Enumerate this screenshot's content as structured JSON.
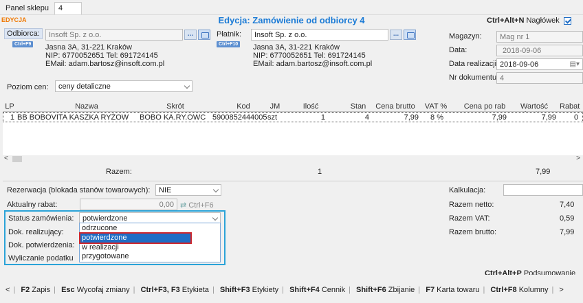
{
  "tabbar": {
    "label": "Panel sklepu",
    "tab_number": "4"
  },
  "mode": "EDYCJA",
  "title": "Edycja: Zamówienie od odbiorcy 4",
  "header_shortcut": {
    "keys": "Ctrl+Alt+N",
    "label": "Nagłówek"
  },
  "customer": {
    "label": "Odbiorca:",
    "shortcut": "Ctrl+F9",
    "value": "Insoft Sp. z o.o.",
    "address": "Jasna 3A, 31-221 Kraków",
    "nip": "NIP: 6770052651 Tel: 691724145",
    "email": "EMail: adam.bartosz@insoft.com.pl"
  },
  "payer": {
    "label": "Płatnik:",
    "shortcut": "Ctrl+F10",
    "value": "Insoft Sp. z o.o.",
    "address": "Jasna 3A, 31-221 Kraków",
    "nip": "NIP: 6770052651 Tel: 691724145",
    "email": "EMail: adam.bartosz@insoft.com.pl"
  },
  "more_button": "...",
  "warehouse": {
    "label": "Magazyn:",
    "value": "Mag nr 1"
  },
  "date": {
    "label": "Data:",
    "value": "2018-09-06"
  },
  "realization_date": {
    "label": "Data realizacji:",
    "value": "2018-09-06"
  },
  "doc_number": {
    "label": "Nr dokumentu:",
    "value": "4"
  },
  "price_level": {
    "label": "Poziom cen:",
    "value": "ceny detaliczne"
  },
  "grid": {
    "headers": [
      "LP",
      "Nazwa",
      "Skrót",
      "Kod",
      "JM",
      "Ilość",
      "Stan",
      "Cena brutto",
      "VAT %",
      "Cena po rab",
      "Wartość brutto",
      "Rabat"
    ],
    "rows": [
      [
        "1",
        "BB BOBOVITA KASZKA RYŻOW",
        "BOBO KA.RY.OWC",
        "5900852444005",
        "szt",
        "1",
        "4",
        "7,99",
        "8 %",
        "7,99",
        "7,99",
        "0"
      ]
    ],
    "totals": {
      "label": "Razem:",
      "qty": "1",
      "value": "7,99"
    }
  },
  "reservation": {
    "label": "Rezerwacja (blokada stanów towarowych):",
    "value": "NIE"
  },
  "discount": {
    "label": "Aktualny rabat:",
    "value": "0,00",
    "shortcut": "Ctrl+F6"
  },
  "status": {
    "label": "Status zamówienia:",
    "value": "potwierdzone",
    "options": [
      "odrzucone",
      "potwierdzone",
      "w realizacji",
      "przygotowane"
    ],
    "highlighted_index": 1
  },
  "dok_realizujacy": "Dok. realizujący:",
  "dok_potwierdzenia": "Dok. potwierdzenia:",
  "tax_calc": "Wyliczanie podatku",
  "summary": {
    "calc_label": "Kalkulacja:",
    "netto_label": "Razem netto:",
    "netto": "7,40",
    "vat_label": "Razem VAT:",
    "vat": "0,59",
    "brutto_label": "Razem brutto:",
    "brutto": "7,99",
    "shortcut": {
      "keys": "Ctrl+Alt+P",
      "label": "Podsumowanie"
    }
  },
  "footer": [
    {
      "keys": "F2",
      "label": "Zapis"
    },
    {
      "keys": "Esc",
      "label": "Wycofaj zmiany"
    },
    {
      "keys": "Ctrl+F3, F3",
      "label": "Etykieta"
    },
    {
      "keys": "Shift+F3",
      "label": "Etykiety"
    },
    {
      "keys": "Shift+F4",
      "label": "Cennik"
    },
    {
      "keys": "Shift+F6",
      "label": "Zbijanie"
    },
    {
      "keys": "F7",
      "label": "Karta towaru"
    },
    {
      "keys": "Ctrl+F8",
      "label": "Kolumny"
    }
  ],
  "colors": {
    "accent": "#1b7bd6",
    "mode": "#f07800",
    "selection": "#1f6dc5",
    "highlight_border": "#d0262b",
    "focus_border": "#2aa3d8"
  }
}
